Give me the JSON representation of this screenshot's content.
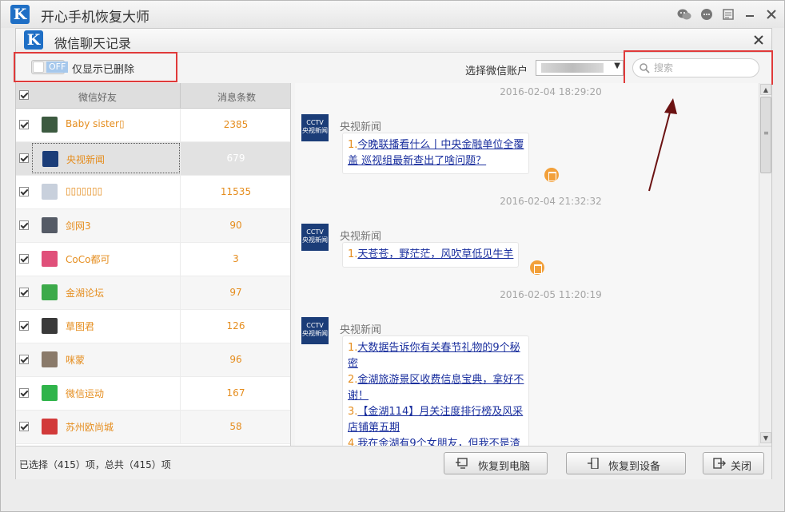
{
  "app": {
    "title": "开心手机恢复大师",
    "logo_letter": "K"
  },
  "dialog": {
    "title": "微信聊天记录",
    "logo_letter": "K"
  },
  "toolbar": {
    "toggle_state": "OFF",
    "toggle_label": "仅显示已删除",
    "account_label": "选择微信账户",
    "search_placeholder": "搜索"
  },
  "table": {
    "columns": [
      "微信好友",
      "消息条数"
    ],
    "rows": [
      {
        "name": "Baby sister▯",
        "count": "2385",
        "avatar": "avatar-photo-icon",
        "color": "#3c5a40"
      },
      {
        "name": "央视新闻",
        "count": "679",
        "avatar": "cctv-news-icon",
        "color": "#1b3d78",
        "selected": true
      },
      {
        "name": "▯▯▯▯▯▯▯",
        "count": "11535",
        "avatar": "group-avatar-icon",
        "color": "#c8d0dc"
      },
      {
        "name": "剑网3",
        "count": "90",
        "avatar": "avatar-photo-icon",
        "color": "#555b66"
      },
      {
        "name": "CoCo都可",
        "count": "3",
        "avatar": "avatar-photo-icon",
        "color": "#e0507a"
      },
      {
        "name": "金湖论坛",
        "count": "97",
        "avatar": "avatar-photo-icon",
        "color": "#3caa4a"
      },
      {
        "name": "草图君",
        "count": "126",
        "avatar": "avatar-photo-icon",
        "color": "#3a3a3a"
      },
      {
        "name": "咪蒙",
        "count": "96",
        "avatar": "avatar-photo-icon",
        "color": "#8a7a6a"
      },
      {
        "name": "微信运动",
        "count": "167",
        "avatar": "wechat-sport-icon",
        "color": "#2fb44a"
      },
      {
        "name": "苏州欧尚城",
        "count": "58",
        "avatar": "avatar-photo-icon",
        "color": "#d23a3a"
      }
    ]
  },
  "chat": {
    "messages": [
      {
        "timestamp": "2016-02-04 18:29:20",
        "sender": "央视新闻",
        "items": [
          {
            "num": "1.",
            "lines": [
              "今晚联播看什么丨中央金融单位全覆",
              "盖 巡视组最新查出了啥问题？"
            ]
          }
        ]
      },
      {
        "timestamp": "2016-02-04 21:32:32",
        "sender": "央视新闻",
        "items": [
          {
            "num": "1.",
            "lines": [
              "天苍苍，野茫茫，风吹草低见牛羊"
            ]
          }
        ]
      },
      {
        "timestamp": "2016-02-05 11:20:19",
        "sender": "央视新闻",
        "items": [
          {
            "num": "1.",
            "lines": [
              "大数据告诉你有关春节礼物的9个秘",
              "密"
            ]
          },
          {
            "num": "2.",
            "lines": [
              "金湖旅游景区收费信息宝典，拿好不",
              "谢！"
            ]
          },
          {
            "num": "3.",
            "lines": [
              "【金湖114】月关注度排行榜及风采",
              "店铺第五期"
            ]
          },
          {
            "num": "4.",
            "lines": [
              "我在金湖有9个女朋友，但我不是渣"
            ]
          }
        ]
      }
    ]
  },
  "footer": {
    "status": "已选择（415）项，总共（415）项",
    "restore_pc": "恢复到电脑",
    "restore_device": "恢复到设备",
    "close": "关闭"
  },
  "colors": {
    "accent": "#e58d1e",
    "highlight": "#e03a3a",
    "link": "#1a2f9e"
  }
}
